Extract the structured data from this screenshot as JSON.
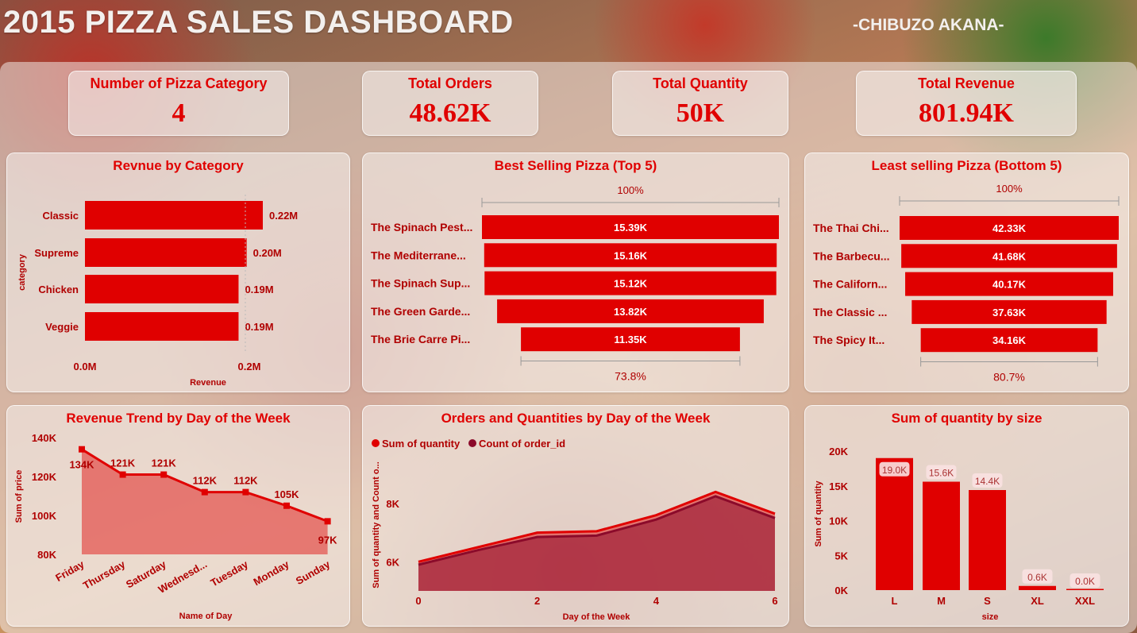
{
  "header": {
    "title": "2015 PIZZA SALES DASHBOARD",
    "author": "-CHIBUZO AKANA-"
  },
  "colors": {
    "accent": "#e00000",
    "dark_series": "#8b0a2a",
    "panel": "#f5f0ee"
  },
  "kpis": [
    {
      "label": "Number of Pizza Category",
      "value": "4"
    },
    {
      "label": "Total Orders",
      "value": "48.62K"
    },
    {
      "label": "Total Quantity",
      "value": "50K"
    },
    {
      "label": "Total Revenue",
      "value": "801.94K"
    }
  ],
  "panels": {
    "revenue_by_category": "Revnue by Category",
    "best_selling": "Best Selling Pizza (Top 5)",
    "least_selling": "Least selling Pizza (Bottom 5)",
    "revenue_trend": "Revenue Trend by Day of the Week",
    "orders_quantities": "Orders and Quantities by Day of the Week",
    "qty_by_size": "Sum of quantity by size"
  },
  "chart_data": [
    {
      "type": "bar",
      "orientation": "horizontal",
      "title": "Revnue by Category",
      "xlabel": "Revenue",
      "ylabel": "category",
      "categories": [
        "Classic",
        "Supreme",
        "Chicken",
        "Veggie"
      ],
      "values": [
        0.22,
        0.2,
        0.19,
        0.19
      ],
      "data_labels": [
        "0.22M",
        "0.20M",
        "0.19M",
        "0.19M"
      ],
      "xlim": [
        0,
        0.22
      ],
      "x_ticks": [
        "0.0M",
        "0.2M"
      ]
    },
    {
      "type": "bar",
      "orientation": "funnel",
      "title": "Best Selling Pizza (Top 5)",
      "categories": [
        "The Spinach Pest...",
        "The Mediterrane...",
        "The Spinach Sup...",
        "The Green Garde...",
        "The Brie Carre Pi..."
      ],
      "values": [
        15.39,
        15.16,
        15.12,
        13.82,
        11.35
      ],
      "data_labels": [
        "15.39K",
        "15.16K",
        "15.12K",
        "13.82K",
        "11.35K"
      ],
      "top_label": "100%",
      "bottom_label": "73.8%"
    },
    {
      "type": "bar",
      "orientation": "funnel",
      "title": "Least selling Pizza (Bottom 5)",
      "categories": [
        "The Thai Chi...",
        "The Barbecu...",
        "The Californ...",
        "The Classic ...",
        "The Spicy It..."
      ],
      "values": [
        42.33,
        41.68,
        40.17,
        37.63,
        34.16
      ],
      "data_labels": [
        "42.33K",
        "41.68K",
        "40.17K",
        "37.63K",
        "34.16K"
      ],
      "top_label": "100%",
      "bottom_label": "80.7%"
    },
    {
      "type": "area",
      "title": "Revenue Trend by Day of the Week",
      "xlabel": "Name of Day",
      "ylabel": "Sum of price",
      "categories": [
        "Friday",
        "Thursday",
        "Saturday",
        "Wednesd...",
        "Tuesday",
        "Monday",
        "Sunday"
      ],
      "values": [
        134,
        121,
        121,
        112,
        112,
        105,
        97
      ],
      "data_labels": [
        "134K",
        "121K",
        "121K",
        "112K",
        "112K",
        "105K",
        "97K"
      ],
      "ylim": [
        80,
        140
      ],
      "y_ticks": [
        "80K",
        "100K",
        "120K",
        "140K"
      ]
    },
    {
      "type": "area",
      "title": "Orders and Quantities by Day of the Week",
      "xlabel": "Day of the Week",
      "ylabel": "Sum of quantity and Count o...",
      "x": [
        0,
        1,
        2,
        3,
        4,
        5,
        6
      ],
      "x_ticks": [
        "0",
        "2",
        "4",
        "6"
      ],
      "y_ticks": [
        "6K",
        "8K"
      ],
      "ylim": [
        5.0,
        8.9
      ],
      "legend": "top-left",
      "series": [
        {
          "name": "Sum of quantity",
          "values": [
            6.0,
            6.5,
            7.0,
            7.05,
            7.6,
            8.4,
            7.65
          ]
        },
        {
          "name": "Count of order_id",
          "values": [
            5.9,
            6.4,
            6.85,
            6.9,
            7.45,
            8.25,
            7.5
          ]
        }
      ]
    },
    {
      "type": "bar",
      "title": "Sum of quantity by size",
      "xlabel": "size",
      "ylabel": "Sum of quantity",
      "categories": [
        "L",
        "M",
        "S",
        "XL",
        "XXL"
      ],
      "values": [
        19.0,
        15.6,
        14.4,
        0.6,
        0.0
      ],
      "data_labels": [
        "19.0K",
        "15.6K",
        "14.4K",
        "0.6K",
        "0.0K"
      ],
      "ylim": [
        0,
        20
      ],
      "y_ticks": [
        "0K",
        "5K",
        "10K",
        "15K",
        "20K"
      ]
    }
  ]
}
